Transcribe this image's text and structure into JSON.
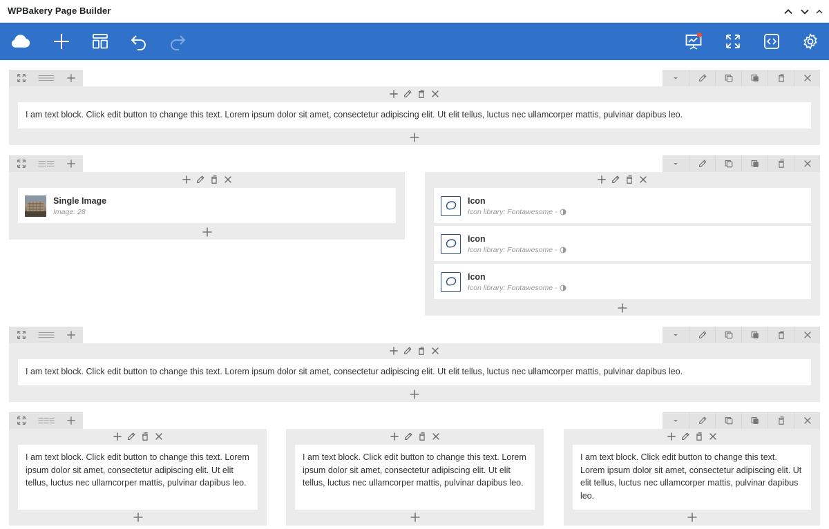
{
  "window": {
    "title": "WPBakery Page Builder"
  },
  "toolbar": {
    "buttons": [
      {
        "name": "logo",
        "icon": "wpbakery-cloud-icon"
      },
      {
        "name": "add-element",
        "icon": "plus-icon"
      },
      {
        "name": "templates",
        "icon": "layout-icon"
      },
      {
        "name": "undo",
        "icon": "undo-icon"
      },
      {
        "name": "redo",
        "icon": "redo-icon"
      }
    ],
    "right_buttons": [
      {
        "name": "seo",
        "icon": "presentation-chart-icon"
      },
      {
        "name": "fullscreen",
        "icon": "expand-icon"
      },
      {
        "name": "custom-css",
        "icon": "code-icon"
      },
      {
        "name": "settings",
        "icon": "gear-icon"
      }
    ]
  },
  "rows": [
    {
      "columns": [
        {
          "elements": [
            {
              "type": "text",
              "text": "I am text block. Click edit button to change this text. Lorem ipsum dolor sit amet, consectetur adipiscing elit. Ut elit tellus, luctus nec ullamcorper mattis, pulvinar dapibus leo."
            }
          ]
        }
      ]
    },
    {
      "columns": [
        {
          "elements": [
            {
              "type": "single_image",
              "name": "Single Image",
              "subtitle": "Image: 28"
            }
          ]
        },
        {
          "elements": [
            {
              "type": "icon",
              "name": "Icon",
              "subtitle": "Icon library: Fontawesome - "
            },
            {
              "type": "icon",
              "name": "Icon",
              "subtitle": "Icon library: Fontawesome - "
            },
            {
              "type": "icon",
              "name": "Icon",
              "subtitle": "Icon library: Fontawesome - "
            }
          ]
        }
      ]
    },
    {
      "columns": [
        {
          "elements": [
            {
              "type": "text",
              "text": "I am text block. Click edit button to change this text. Lorem ipsum dolor sit amet, consectetur adipiscing elit. Ut elit tellus, luctus nec ullamcorper mattis, pulvinar dapibus leo."
            }
          ]
        }
      ]
    },
    {
      "columns": [
        {
          "elements": [
            {
              "type": "text",
              "text": "I am text block. Click edit button to change this text. Lorem ipsum dolor sit amet, consectetur adipiscing elit. Ut elit tellus, luctus nec ullamcorper mattis, pulvinar dapibus leo."
            }
          ]
        },
        {
          "elements": [
            {
              "type": "text",
              "text": "I am text block. Click edit button to change this text. Lorem ipsum dolor sit amet, consectetur adipiscing elit. Ut elit tellus, luctus nec ullamcorper mattis, pulvinar dapibus leo."
            }
          ]
        },
        {
          "elements": [
            {
              "type": "text",
              "text": "I am text block. Click edit button to change this text. Lorem ipsum dolor sit amet, consectetur adipiscing elit. Ut elit tellus, luctus nec ullamcorper mattis, pulvinar dapibus leo."
            }
          ]
        }
      ]
    }
  ],
  "colors": {
    "toolbar": "#3071c9",
    "column_bg": "#ebebeb",
    "control_bg": "#e3e3e3",
    "notification_dot": "#e84c3d",
    "icon_border": "#2f4f7f"
  }
}
